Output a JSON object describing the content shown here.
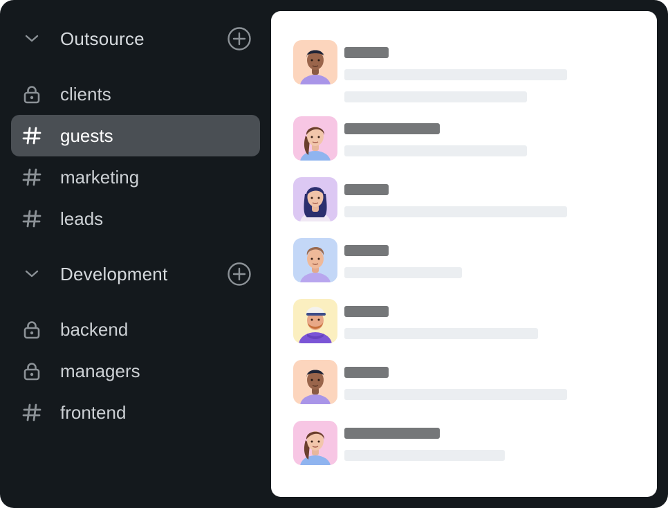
{
  "colors": {
    "background": "#14191d",
    "active_channel": "#4a4f54",
    "panel": "#ffffff",
    "placeholder_name": "#757779",
    "placeholder_line": "#ebeef1"
  },
  "sidebar": {
    "groups": [
      {
        "name": "Outsource",
        "channels": [
          {
            "label": "clients",
            "icon": "lock-icon",
            "active": false
          },
          {
            "label": "guests",
            "icon": "hash-icon",
            "active": true
          },
          {
            "label": "marketing",
            "icon": "hash-icon",
            "active": false
          },
          {
            "label": "leads",
            "icon": "hash-icon",
            "active": false
          }
        ]
      },
      {
        "name": "Development",
        "channels": [
          {
            "label": "backend",
            "icon": "lock-icon",
            "active": false
          },
          {
            "label": "managers",
            "icon": "lock-icon",
            "active": false
          },
          {
            "label": "frontend",
            "icon": "hash-icon",
            "active": false
          }
        ]
      }
    ]
  },
  "messages": [
    {
      "avatar": "man-dark-hair-avatar",
      "avatar_bg": "#fcd5bd",
      "placeholder_lines": 2
    },
    {
      "avatar": "woman-ponytail-avatar",
      "avatar_bg": "#f7c6e4",
      "placeholder_lines": 1
    },
    {
      "avatar": "woman-long-hair-avatar",
      "avatar_bg": "#dcc8f3",
      "placeholder_lines": 1
    },
    {
      "avatar": "man-curly-hair-avatar",
      "avatar_bg": "#c3d7f7",
      "placeholder_lines": 1
    },
    {
      "avatar": "man-cap-beard-avatar",
      "avatar_bg": "#fbefc0",
      "placeholder_lines": 1
    },
    {
      "avatar": "man-dark-hair-avatar",
      "avatar_bg": "#fcd5bd",
      "placeholder_lines": 1
    },
    {
      "avatar": "woman-ponytail-avatar",
      "avatar_bg": "#f7c6e4",
      "placeholder_lines": 1
    }
  ]
}
